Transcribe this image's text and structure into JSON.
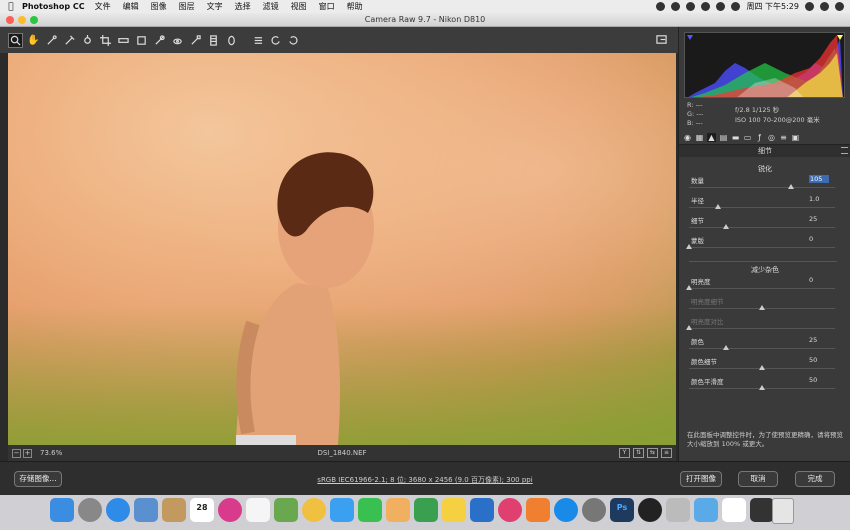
{
  "menubar": {
    "app": "Photoshop CC",
    "items": [
      "文件",
      "编辑",
      "图像",
      "图层",
      "文字",
      "选择",
      "滤镜",
      "视图",
      "窗口",
      "帮助"
    ],
    "clock": "周四 下午5:29"
  },
  "window": {
    "title": "Camera Raw 9.7  -  Nikon D810"
  },
  "canvas": {
    "zoom": "73.6%",
    "filename": "DSI_1840.NEF"
  },
  "info": {
    "r": "R:  ---",
    "g": "G:  ---",
    "b": "B:  ---",
    "aperture_shutter": "f/2.8   1/125 秒",
    "iso_lens": "ISO 100    70-200@200 毫米"
  },
  "panel": {
    "section_title": "细节",
    "sharpen_title": "锐化",
    "noise_title": "减少杂色",
    "help_text": "在此面板中调整控件时，为了使预览更精确，请将预览大小缩放到 100% 或更大。"
  },
  "sharpen": [
    {
      "label": "数量",
      "value": "105",
      "level": 0.7
    },
    {
      "label": "半径",
      "value": "1.0",
      "level": 0.2
    },
    {
      "label": "细节",
      "value": "25",
      "level": 0.25
    },
    {
      "label": "蒙版",
      "value": "0",
      "level": 0.0
    }
  ],
  "noise": [
    {
      "label": "明亮度",
      "value": "0",
      "level": 0.0
    },
    {
      "label": "明亮度细节",
      "value": "",
      "level": 0.5
    },
    {
      "label": "明亮度对比",
      "value": "",
      "level": 0.0
    },
    {
      "label": "颜色",
      "value": "25",
      "level": 0.25
    },
    {
      "label": "颜色细节",
      "value": "50",
      "level": 0.5
    },
    {
      "label": "颜色平滑度",
      "value": "50",
      "level": 0.5
    }
  ],
  "bottom": {
    "save_label": "存储图像...",
    "workflow": "sRGB IEC61966-2.1; 8 位; 3680 x 2456 (9.0 百万像素); 300 ppi",
    "open_label": "打开图像",
    "cancel_label": "取消",
    "done_label": "完成"
  },
  "dock": {
    "calendar_day": "28",
    "ps_label": "Ps"
  },
  "colors": {
    "accent": "#3d6bb0",
    "panel": "#3a3a3a",
    "toolbar": "#3c3c3c"
  }
}
